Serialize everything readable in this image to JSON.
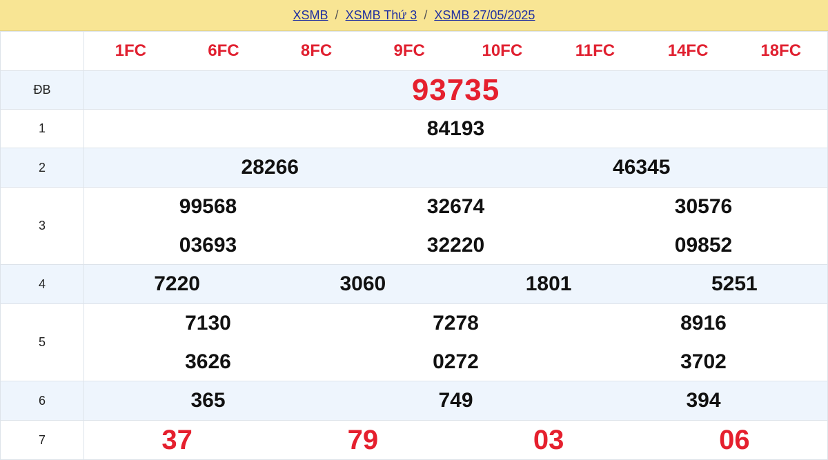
{
  "breadcrumb": {
    "items": [
      "XSMB",
      "XSMB Thứ 3",
      "XSMB 27/05/2025"
    ],
    "separator": "/"
  },
  "codes": [
    "1FC",
    "6FC",
    "8FC",
    "9FC",
    "10FC",
    "11FC",
    "14FC",
    "18FC"
  ],
  "prizes": {
    "db": {
      "label": "ĐB",
      "numbers": [
        "93735"
      ]
    },
    "p1": {
      "label": "1",
      "numbers": [
        "84193"
      ]
    },
    "p2": {
      "label": "2",
      "numbers": [
        "28266",
        "46345"
      ]
    },
    "p3": {
      "label": "3",
      "numbers": [
        "99568",
        "32674",
        "30576",
        "03693",
        "32220",
        "09852"
      ]
    },
    "p4": {
      "label": "4",
      "numbers": [
        "7220",
        "3060",
        "1801",
        "5251"
      ]
    },
    "p5": {
      "label": "5",
      "numbers": [
        "7130",
        "7278",
        "8916",
        "3626",
        "0272",
        "3702"
      ]
    },
    "p6": {
      "label": "6",
      "numbers": [
        "365",
        "749",
        "394"
      ]
    },
    "p7": {
      "label": "7",
      "numbers": [
        "37",
        "79",
        "03",
        "06"
      ]
    }
  },
  "colors": {
    "header_bg": "#f8e594",
    "alt_row_bg": "#eef5fd",
    "accent_red": "#e5202e",
    "link_blue": "#1f2fa0"
  }
}
